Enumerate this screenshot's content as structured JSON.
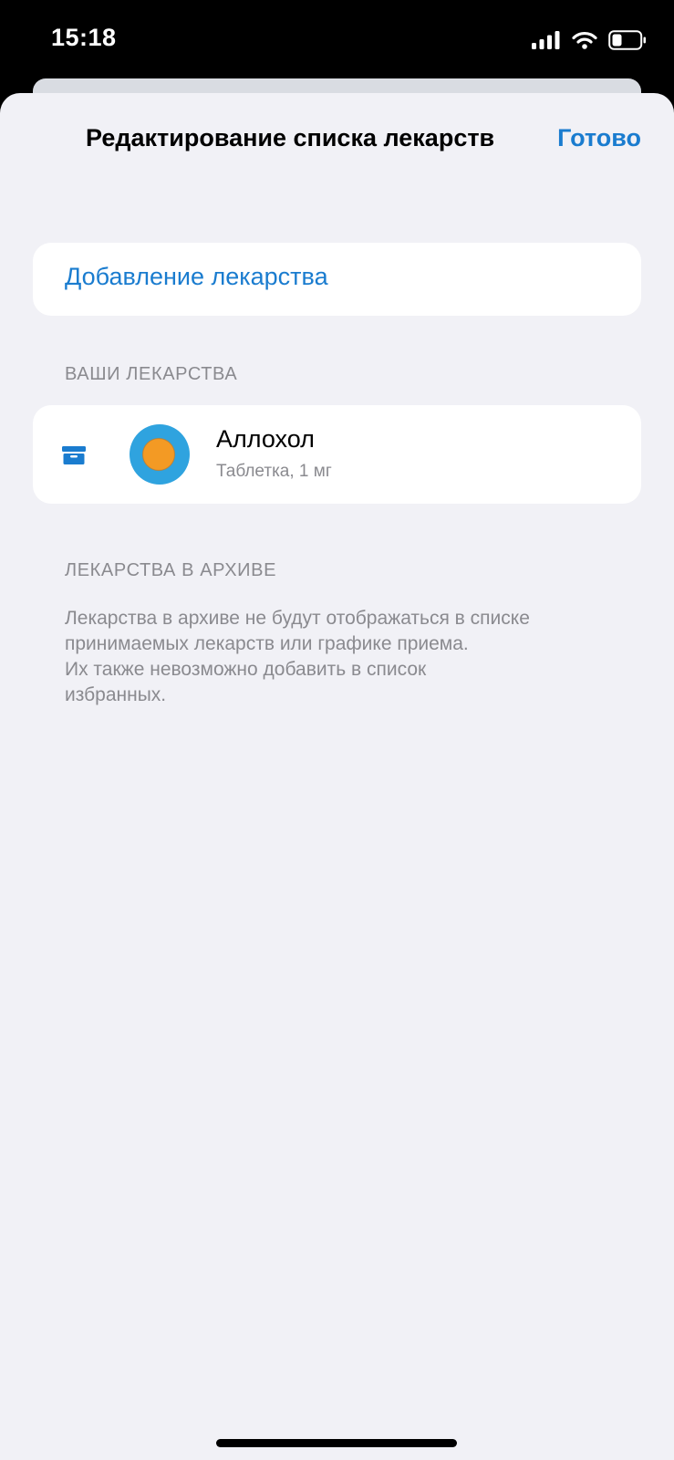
{
  "status_bar": {
    "time": "15:18",
    "icons": [
      "signal-icon",
      "wifi-icon",
      "battery-icon"
    ]
  },
  "nav": {
    "title": "Редактирование списка лекарств",
    "done_label": "Готово"
  },
  "add_section": {
    "add_label": "Добавление лекарства"
  },
  "your_meds": {
    "header": "ВАШИ ЛЕКАРСТВА",
    "items": [
      {
        "name": "Аллохол",
        "detail": "Таблетка, 1 мг",
        "action_icon": "archive-icon",
        "image_icon": "pill-icon"
      }
    ]
  },
  "archive": {
    "header": "ЛЕКАРСТВА В АРХИВЕ",
    "note_lines": [
      "Лекарства в архиве не будут отображаться в списке",
      "принимаемых лекарств или графике приема.",
      "Их также невозможно добавить в список",
      "избранных."
    ]
  },
  "colors": {
    "accent": "#1a7ccf",
    "sheet_background": "#f1f1f6",
    "card_background": "#ffffff",
    "secondary_text": "#8a8a8f",
    "pill_outer": "#2fa3df",
    "pill_inner": "#f39a24"
  }
}
